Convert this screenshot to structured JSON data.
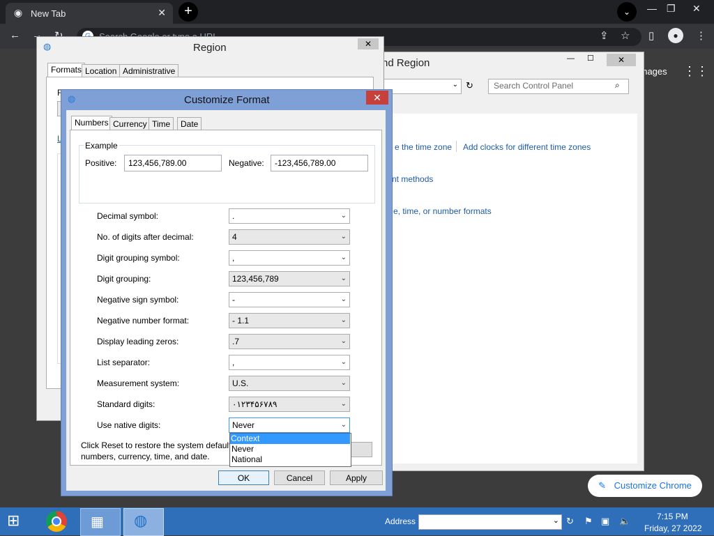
{
  "chrome": {
    "tab_title": "New Tab",
    "tab_close": "✕",
    "new_tab": "+",
    "omnibox_placeholder": "Search Google or type a URL",
    "images_link": "Images",
    "customize_chrome": "Customize Chrome",
    "icons": [
      "chrome-icon",
      "back-icon",
      "forward-icon",
      "reload-icon",
      "share-icon",
      "star-icon",
      "sidepanel-icon",
      "profile-icon",
      "menu-icon",
      "apps-icon",
      "pencil-icon"
    ]
  },
  "control_panel": {
    "title": "Clock, Language, and Region",
    "title_visible": "nd Region",
    "search_placeholder": "Search Control Panel",
    "links": [
      "e the time zone",
      "Add clocks for different time zones",
      "nt methods",
      "e, time, or number formats"
    ]
  },
  "region": {
    "title": "Region",
    "tabs": [
      "Formats",
      "Location",
      "Administrative"
    ],
    "frag_f": "F",
    "frag_l": "L"
  },
  "customize_format": {
    "title": "Customize Format",
    "close": "✕",
    "tabs": [
      "Numbers",
      "Currency",
      "Time",
      "Date"
    ],
    "example": {
      "label": "Example",
      "positive_label": "Positive:",
      "positive_value": "123,456,789.00",
      "negative_label": "Negative:",
      "negative_value": "-123,456,789.00"
    },
    "settings": [
      {
        "label": "Decimal symbol:",
        "value": "."
      },
      {
        "label": "No. of digits after decimal:",
        "value": "4"
      },
      {
        "label": "Digit grouping symbol:",
        "value": ","
      },
      {
        "label": "Digit grouping:",
        "value": "123,456,789"
      },
      {
        "label": "Negative sign symbol:",
        "value": "-"
      },
      {
        "label": "Negative number format:",
        "value": "- 1.1"
      },
      {
        "label": "Display leading zeros:",
        "value": ".7"
      },
      {
        "label": "List separator:",
        "value": ","
      },
      {
        "label": "Measurement system:",
        "value": "U.S."
      },
      {
        "label": "Standard digits:",
        "value": "۰۱۲۳۴۵۶۷۸۹"
      },
      {
        "label": "Use native digits:",
        "value": "Never"
      }
    ],
    "dropdown_options": [
      "Context",
      "Never",
      "National"
    ],
    "dropdown_selected": "Context",
    "reset_text": "Click Reset to restore the system default settings for numbers, currency, time, and date.",
    "reset_text_visible": "Click Reset to restore the system default numbers, currency, time, and date.",
    "buttons": {
      "ok": "OK",
      "cancel": "Cancel",
      "apply": "Apply"
    }
  },
  "taskbar": {
    "address_label": "Address",
    "time": "7:15 PM",
    "date": "Friday, 27 2022"
  },
  "colors": {
    "taskbar": "#2f6fba",
    "dialog_frame": "#7f9fd7",
    "selection": "#3399ff",
    "close_red": "#c6403c",
    "link": "#1e5ba6"
  }
}
